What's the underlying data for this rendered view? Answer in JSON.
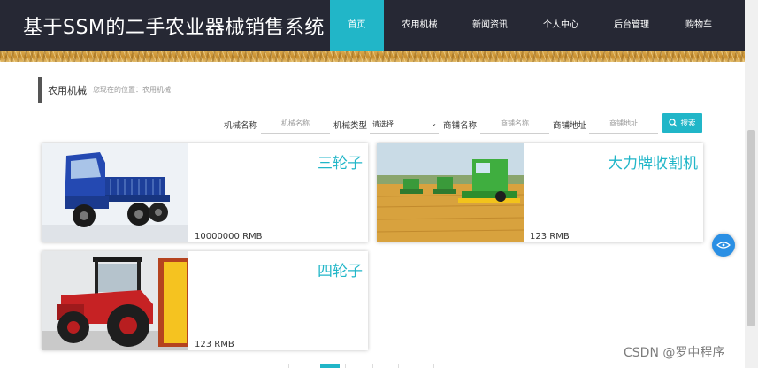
{
  "header": {
    "site_title": "基于SSM的二手农业器械销售系统",
    "nav": [
      {
        "label": "首页",
        "active": true
      },
      {
        "label": "农用机械",
        "active": false
      },
      {
        "label": "新闻资讯",
        "active": false
      },
      {
        "label": "个人中心",
        "active": false
      },
      {
        "label": "后台管理",
        "active": false
      },
      {
        "label": "购物车",
        "active": false
      }
    ]
  },
  "breadcrumb": {
    "title": "农用机械",
    "position": "您现在的位置：农用机械"
  },
  "search": {
    "machine_name_label": "机械名称",
    "machine_name_placeholder": "机械名称",
    "machine_type_label": "机械类型",
    "machine_type_value": "请选择",
    "shop_name_label": "商铺名称",
    "shop_name_placeholder": "商铺名称",
    "shop_address_label": "商铺地址",
    "shop_address_placeholder": "商铺地址",
    "button_label": "搜索",
    "button_icon": "search-icon"
  },
  "products": [
    {
      "name": "三轮子",
      "price": "10000000 RMB",
      "image": "blue-tricycle-truck"
    },
    {
      "name": "大力牌收割机",
      "price": "123 RMB",
      "image": "combine-harvester-in-wheat-field"
    },
    {
      "name": "四轮子",
      "price": "123 RMB",
      "image": "red-tractor"
    }
  ],
  "float_button_icon": "chat-icon",
  "watermark": "CSDN @罗中程序",
  "colors": {
    "header_bg": "#262834",
    "accent": "#21b6c8",
    "text": "#333333",
    "muted": "#999999"
  }
}
